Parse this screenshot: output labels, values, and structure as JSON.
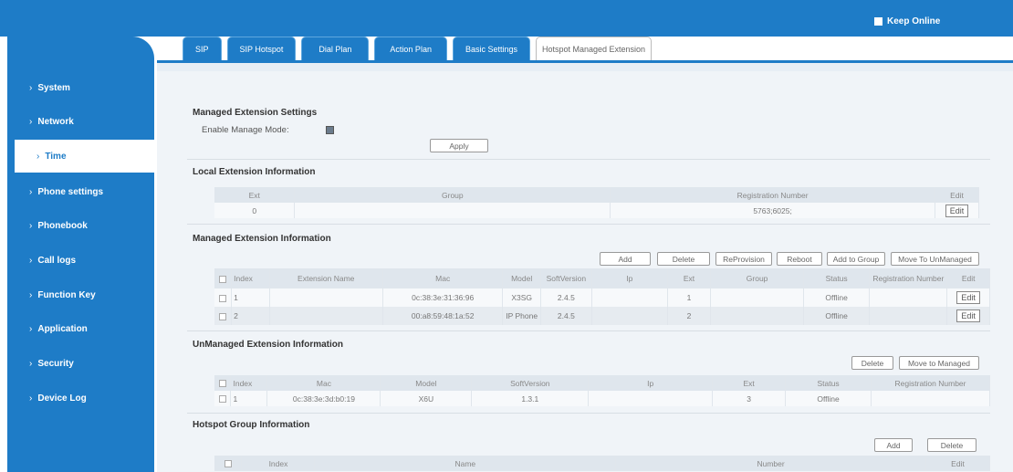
{
  "header": {
    "keep_online": "Keep Online"
  },
  "sidebar": {
    "items": [
      {
        "label": "System"
      },
      {
        "label": "Network"
      },
      {
        "label": "Time"
      },
      {
        "label": "Phone settings"
      },
      {
        "label": "Phonebook"
      },
      {
        "label": "Call logs"
      },
      {
        "label": "Function Key"
      },
      {
        "label": "Application"
      },
      {
        "label": "Security"
      },
      {
        "label": "Device Log"
      }
    ]
  },
  "tabs": [
    "SIP",
    "SIP Hotspot",
    "Dial Plan",
    "Action Plan",
    "Basic Settings",
    "Hotspot Managed Extension"
  ],
  "managed_settings": {
    "title": "Managed Extension Settings",
    "enable_label": "Enable Manage Mode:",
    "apply": "Apply"
  },
  "local_ext": {
    "title": "Local Extension Information",
    "headers": [
      "Ext",
      "Group",
      "Registration Number",
      "Edit"
    ],
    "row": {
      "ext": "0",
      "group": "",
      "reg": "5763;6025;",
      "edit": "Edit"
    }
  },
  "managed_ext": {
    "title": "Managed Extension Information",
    "buttons": [
      "Add",
      "Delete",
      "ReProvision",
      "Reboot",
      "Add to Group",
      "Move To UnManaged"
    ],
    "headers": [
      "",
      "Index",
      "Extension Name",
      "Mac",
      "Model",
      "SoftVersion",
      "Ip",
      "Ext",
      "Group",
      "Status",
      "Registration Number",
      "Edit"
    ],
    "rows": [
      {
        "index": "1",
        "name": "",
        "mac": "0c:38:3e:31:36:96",
        "model": "X3SG",
        "ver": "2.4.5",
        "ip": "",
        "ext": "1",
        "group": "",
        "status": "Offline",
        "reg": "",
        "edit": "Edit"
      },
      {
        "index": "2",
        "name": "",
        "mac": "00:a8:59:48:1a:52",
        "model": "IP Phone",
        "ver": "2.4.5",
        "ip": "",
        "ext": "2",
        "group": "",
        "status": "Offline",
        "reg": "",
        "edit": "Edit"
      }
    ]
  },
  "unmanaged_ext": {
    "title": "UnManaged Extension Information",
    "buttons": [
      "Delete",
      "Move to Managed"
    ],
    "headers": [
      "",
      "Index",
      "Mac",
      "Model",
      "SoftVersion",
      "Ip",
      "Ext",
      "Status",
      "Registration Number"
    ],
    "rows": [
      {
        "index": "1",
        "mac": "0c:38:3e:3d:b0:19",
        "model": "X6U",
        "ver": "1.3.1",
        "ip": "",
        "ext": "3",
        "status": "Offline",
        "reg": ""
      }
    ]
  },
  "hotspot_group": {
    "title": "Hotspot Group Information",
    "buttons": [
      "Add",
      "Delete"
    ],
    "headers": [
      "",
      "Index",
      "Name",
      "Number",
      "Edit"
    ]
  },
  "colors": {
    "brand": "#1e7cc7",
    "content_bg": "#f0f4f8"
  }
}
